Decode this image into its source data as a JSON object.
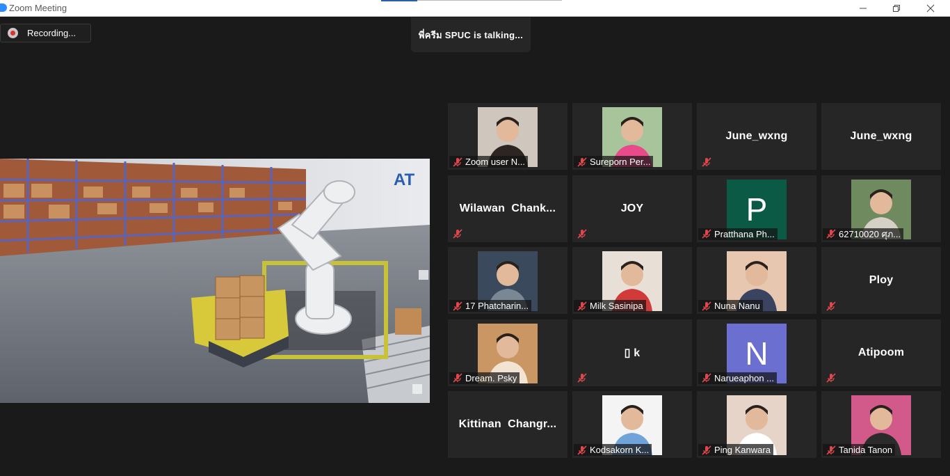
{
  "window": {
    "title": "Zoom Meeting"
  },
  "recording": {
    "label": "Recording..."
  },
  "talking_indicator": {
    "text": "พี่ครีม SPUC is talking..."
  },
  "colors": {
    "background": "#1a1a1a",
    "tile": "#262626",
    "muted_mic": "#e0474c",
    "recording_dot": "#d9332b",
    "avatar_P": "#0b5a46",
    "avatar_N": "#6a6fd0"
  },
  "shared_screen": {
    "logo_text": "AT"
  },
  "participants": [
    {
      "name": "Zoom user N...",
      "display": "photo",
      "muted": true
    },
    {
      "name": "Sureporn Per...",
      "display": "photo",
      "muted": true
    },
    {
      "name": "June_wxng",
      "display": "name",
      "muted": true
    },
    {
      "name": "June_wxng",
      "display": "name",
      "muted": false
    },
    {
      "name": "Wilawan  Chank...",
      "display": "name",
      "muted": true
    },
    {
      "name": "JOY",
      "display": "name",
      "muted": true
    },
    {
      "name": "Pratthana Ph...",
      "display": "letter",
      "letter": "P",
      "muted": true
    },
    {
      "name": "62710020 ศุภ...",
      "display": "photo",
      "muted": true
    },
    {
      "name": "17 Phatcharin...",
      "display": "photo",
      "muted": true
    },
    {
      "name": "Milk Sasinipa",
      "display": "photo",
      "muted": true
    },
    {
      "name": "Nuna Nanu",
      "display": "photo",
      "muted": true
    },
    {
      "name": "Ploy",
      "display": "name",
      "muted": true
    },
    {
      "name": "Dream. Psky",
      "display": "photo",
      "muted": true
    },
    {
      "name": "▯ k",
      "display": "name",
      "muted": true
    },
    {
      "name": "Narueaphon ...",
      "display": "letter",
      "letter": "N",
      "muted": true
    },
    {
      "name": "Atipoom",
      "display": "name",
      "muted": true
    },
    {
      "name": "Kittinan  Changr...",
      "display": "name",
      "muted": false
    },
    {
      "name": "Kodsakorn K...",
      "display": "photo",
      "muted": true
    },
    {
      "name": "Ping Kanwara",
      "display": "photo",
      "muted": true
    },
    {
      "name": "Tanida Tanon",
      "display": "photo",
      "muted": true
    }
  ]
}
